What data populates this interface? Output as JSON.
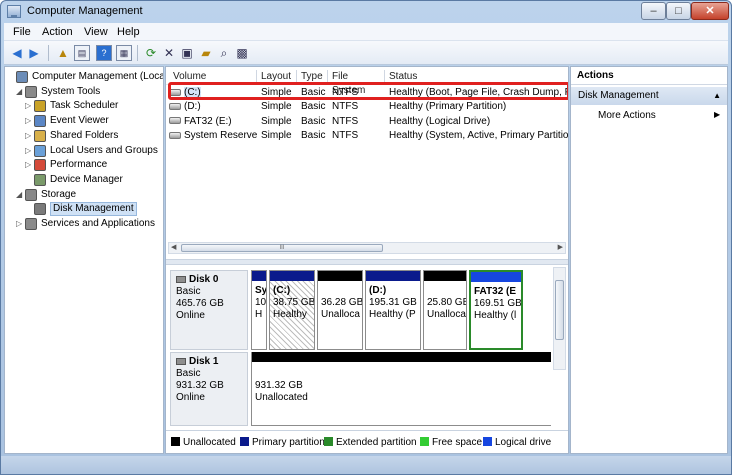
{
  "window": {
    "title": "Computer Management",
    "controls": {
      "minimize": "–",
      "maximize": "□",
      "close": "✕"
    }
  },
  "menu": [
    "File",
    "Action",
    "View",
    "Help"
  ],
  "toolbar_icons": [
    "back-arrow-icon",
    "forward-arrow-icon",
    "up-folder-icon",
    "show-hide-tree-icon",
    "help-icon",
    "properties-icon",
    "refresh-icon",
    "delete-icon",
    "disk-properties-icon",
    "open-icon",
    "search-icon",
    "export-icon"
  ],
  "tree": [
    {
      "label": "Computer Management (Local",
      "level": 0,
      "expander": "",
      "icon": "computer-icon"
    },
    {
      "label": "System Tools",
      "level": 1,
      "expander": "◢",
      "icon": "tools-icon"
    },
    {
      "label": "Task Scheduler",
      "level": 2,
      "expander": "▷",
      "icon": "clock-icon"
    },
    {
      "label": "Event Viewer",
      "level": 2,
      "expander": "▷",
      "icon": "event-viewer-icon"
    },
    {
      "label": "Shared Folders",
      "level": 2,
      "expander": "▷",
      "icon": "shared-folder-icon"
    },
    {
      "label": "Local Users and Groups",
      "level": 2,
      "expander": "▷",
      "icon": "users-icon"
    },
    {
      "label": "Performance",
      "level": 2,
      "expander": "▷",
      "icon": "performance-icon"
    },
    {
      "label": "Device Manager",
      "level": 2,
      "expander": "",
      "icon": "device-manager-icon"
    },
    {
      "label": "Storage",
      "level": 1,
      "expander": "◢",
      "icon": "storage-icon"
    },
    {
      "label": "Disk Management",
      "level": 2,
      "expander": "",
      "icon": "disk-management-icon",
      "selected": true
    },
    {
      "label": "Services and Applications",
      "level": 1,
      "expander": "▷",
      "icon": "services-icon"
    }
  ],
  "volume_columns": [
    "Volume",
    "Layout",
    "Type",
    "File System",
    "Status"
  ],
  "volumes": [
    {
      "volume": "(C:)",
      "layout": "Simple",
      "type": "Basic",
      "fs": "NTFS",
      "status": "Healthy (Boot, Page File, Crash Dump, Pr",
      "selected": true
    },
    {
      "volume": "(D:)",
      "layout": "Simple",
      "type": "Basic",
      "fs": "NTFS",
      "status": "Healthy (Primary Partition)"
    },
    {
      "volume": "FAT32 (E:)",
      "layout": "Simple",
      "type": "Basic",
      "fs": "NTFS",
      "status": "Healthy (Logical Drive)"
    },
    {
      "volume": "System Reserved",
      "layout": "Simple",
      "type": "Basic",
      "fs": "NTFS",
      "status": "Healthy (System, Active, Primary Partition"
    }
  ],
  "scroll_grip": "III",
  "disks": [
    {
      "name": "Disk 0",
      "type": "Basic",
      "size": "465.76 GB",
      "state": "Online",
      "partitions": [
        {
          "title": "Sy",
          "size": "10",
          "status": "H",
          "bar": "#0a1a8c",
          "hatch": false,
          "selected": false
        },
        {
          "title": "(C:)",
          "size": "38.75 GB",
          "status": "Healthy",
          "bar": "#0a1a8c",
          "hatch": true,
          "selected": false
        },
        {
          "title": "",
          "size": "36.28 GB",
          "status": "Unalloca",
          "bar": "#000000",
          "hatch": false,
          "selected": false
        },
        {
          "title": "(D:)",
          "size": "195.31 GB",
          "status": "Healthy (P",
          "bar": "#0a1a8c",
          "hatch": false,
          "selected": false
        },
        {
          "title": "",
          "size": "25.80 GB",
          "status": "Unalloca",
          "bar": "#000000",
          "hatch": false,
          "selected": false
        },
        {
          "title": "FAT32  (E",
          "size": "169.51 GB",
          "status": "Healthy (l",
          "bar": "#1646e0",
          "hatch": false,
          "selected": true
        }
      ]
    },
    {
      "name": "Disk 1",
      "type": "Basic",
      "size": "931.32 GB",
      "state": "Online",
      "partitions": [
        {
          "title": "",
          "size": "931.32 GB",
          "status": "Unallocated",
          "bar": "#000000",
          "hatch": false,
          "selected": false
        }
      ]
    }
  ],
  "legend": [
    {
      "label": "Unallocated",
      "color": "#000000"
    },
    {
      "label": "Primary partition",
      "color": "#0a1a8c"
    },
    {
      "label": "Extended partition",
      "color": "#2a8a2a"
    },
    {
      "label": "Free space",
      "color": "#33cc33"
    },
    {
      "label": "Logical drive",
      "color": "#1646e0"
    }
  ],
  "actions": {
    "title": "Actions",
    "section": "Disk Management",
    "items": [
      "More Actions"
    ]
  },
  "colors": {
    "highlight": "#e0201f",
    "selection": "#cfe1f5",
    "chrome": "#bcd3ec"
  }
}
